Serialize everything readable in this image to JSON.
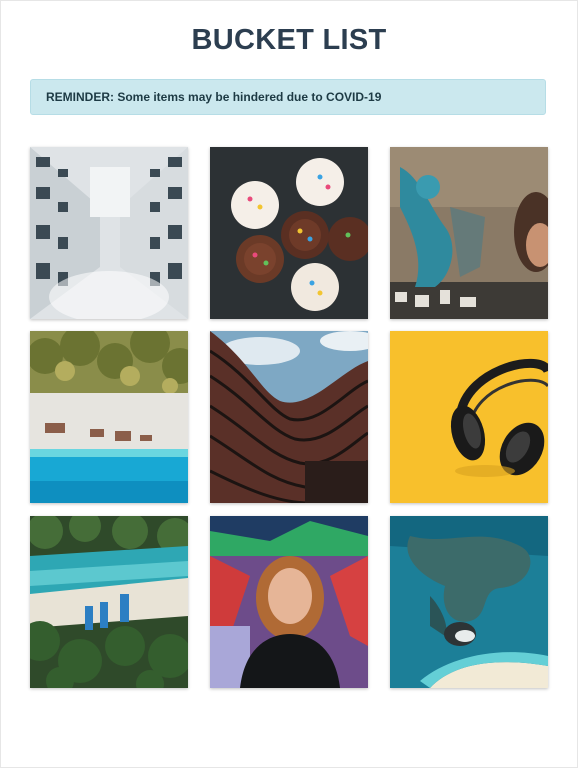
{
  "page": {
    "title": "BUCKET LIST"
  },
  "alert": {
    "text": "REMINDER: Some items may be hindered due to COVID-19"
  },
  "photos": [
    {
      "subject": "building-looking-up"
    },
    {
      "subject": "cupcakes"
    },
    {
      "subject": "graffiti-wall"
    },
    {
      "subject": "aerial-beach-palms"
    },
    {
      "subject": "curved-building"
    },
    {
      "subject": "headphones-on-yellow"
    },
    {
      "subject": "aerial-boats-beach"
    },
    {
      "subject": "portrait-graffiti"
    },
    {
      "subject": "aerial-reef-island"
    }
  ]
}
